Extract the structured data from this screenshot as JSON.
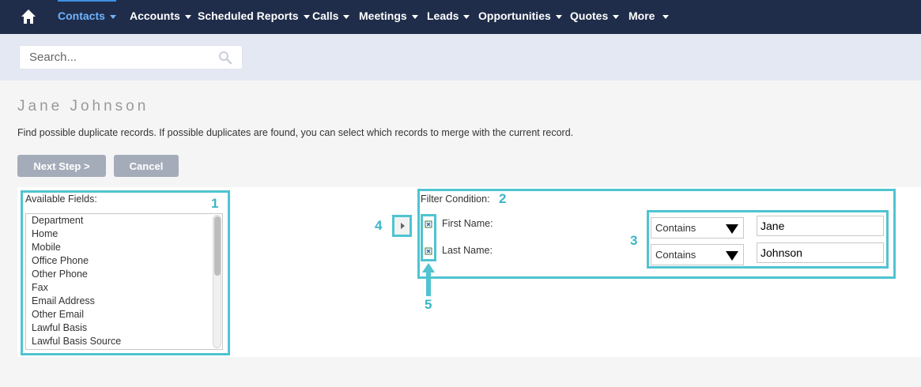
{
  "nav": {
    "items": [
      {
        "label": "Contacts",
        "active": true
      },
      {
        "label": "Accounts"
      },
      {
        "label": "Scheduled Reports"
      },
      {
        "label": "Calls"
      },
      {
        "label": "Meetings"
      },
      {
        "label": "Leads"
      },
      {
        "label": "Opportunities"
      },
      {
        "label": "Quotes"
      },
      {
        "label": "More"
      }
    ],
    "home_icon": "home-icon"
  },
  "search": {
    "placeholder": "Search...",
    "icon": "search-icon"
  },
  "page": {
    "title": "Jane Johnson",
    "description": "Find possible duplicate records. If possible duplicates are found, you can select which records to merge with the current record."
  },
  "buttons": {
    "next": "Next Step >",
    "cancel": "Cancel"
  },
  "available_fields": {
    "label": "Available Fields:",
    "items": [
      "Department",
      "Home",
      "Mobile",
      "Office Phone",
      "Other Phone",
      "Fax",
      "Email Address",
      "Other Email",
      "Lawful Basis",
      "Lawful Basis Source"
    ]
  },
  "filter": {
    "label": "Filter Condition:",
    "conditions": [
      {
        "field": "First Name:",
        "operator": "Contains",
        "value": "Jane"
      },
      {
        "field": "Last Name:",
        "operator": "Contains",
        "value": "Johnson"
      }
    ]
  },
  "markers": [
    "1",
    "2",
    "3",
    "4",
    "5"
  ],
  "colors": {
    "nav_bg": "#1f2d4a",
    "active_nav": "#6fb3ff",
    "highlight": "#4fc4d0",
    "button": "#a5acb9"
  }
}
